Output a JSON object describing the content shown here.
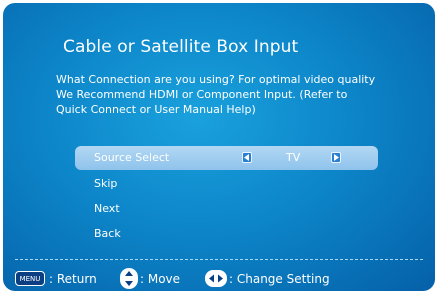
{
  "dialog": {
    "title": "Cable or Satellite Box Input",
    "description_lines": [
      "What Connection are you using? For optimal video quality",
      "We Recommend HDMI or Component Input. (Refer to",
      "Quick Connect or User Manual Help)"
    ]
  },
  "menu": {
    "items": [
      {
        "label": "Source Select",
        "value": "TV",
        "selected": true
      },
      {
        "label": "Skip"
      },
      {
        "label": "Next"
      },
      {
        "label": "Back"
      }
    ]
  },
  "footer": {
    "menu_key": "MENU",
    "return_label": ": Return",
    "move_label": ": Move",
    "change_label": ": Change Setting"
  },
  "icons": {
    "left_arrow": "left-arrow-icon",
    "right_arrow": "right-arrow-icon",
    "updown": "up-down-icon",
    "leftright": "left-right-icon"
  },
  "colors": {
    "background": "#0d86c9",
    "highlight": "#a6d0f1",
    "text": "#ffffff"
  }
}
